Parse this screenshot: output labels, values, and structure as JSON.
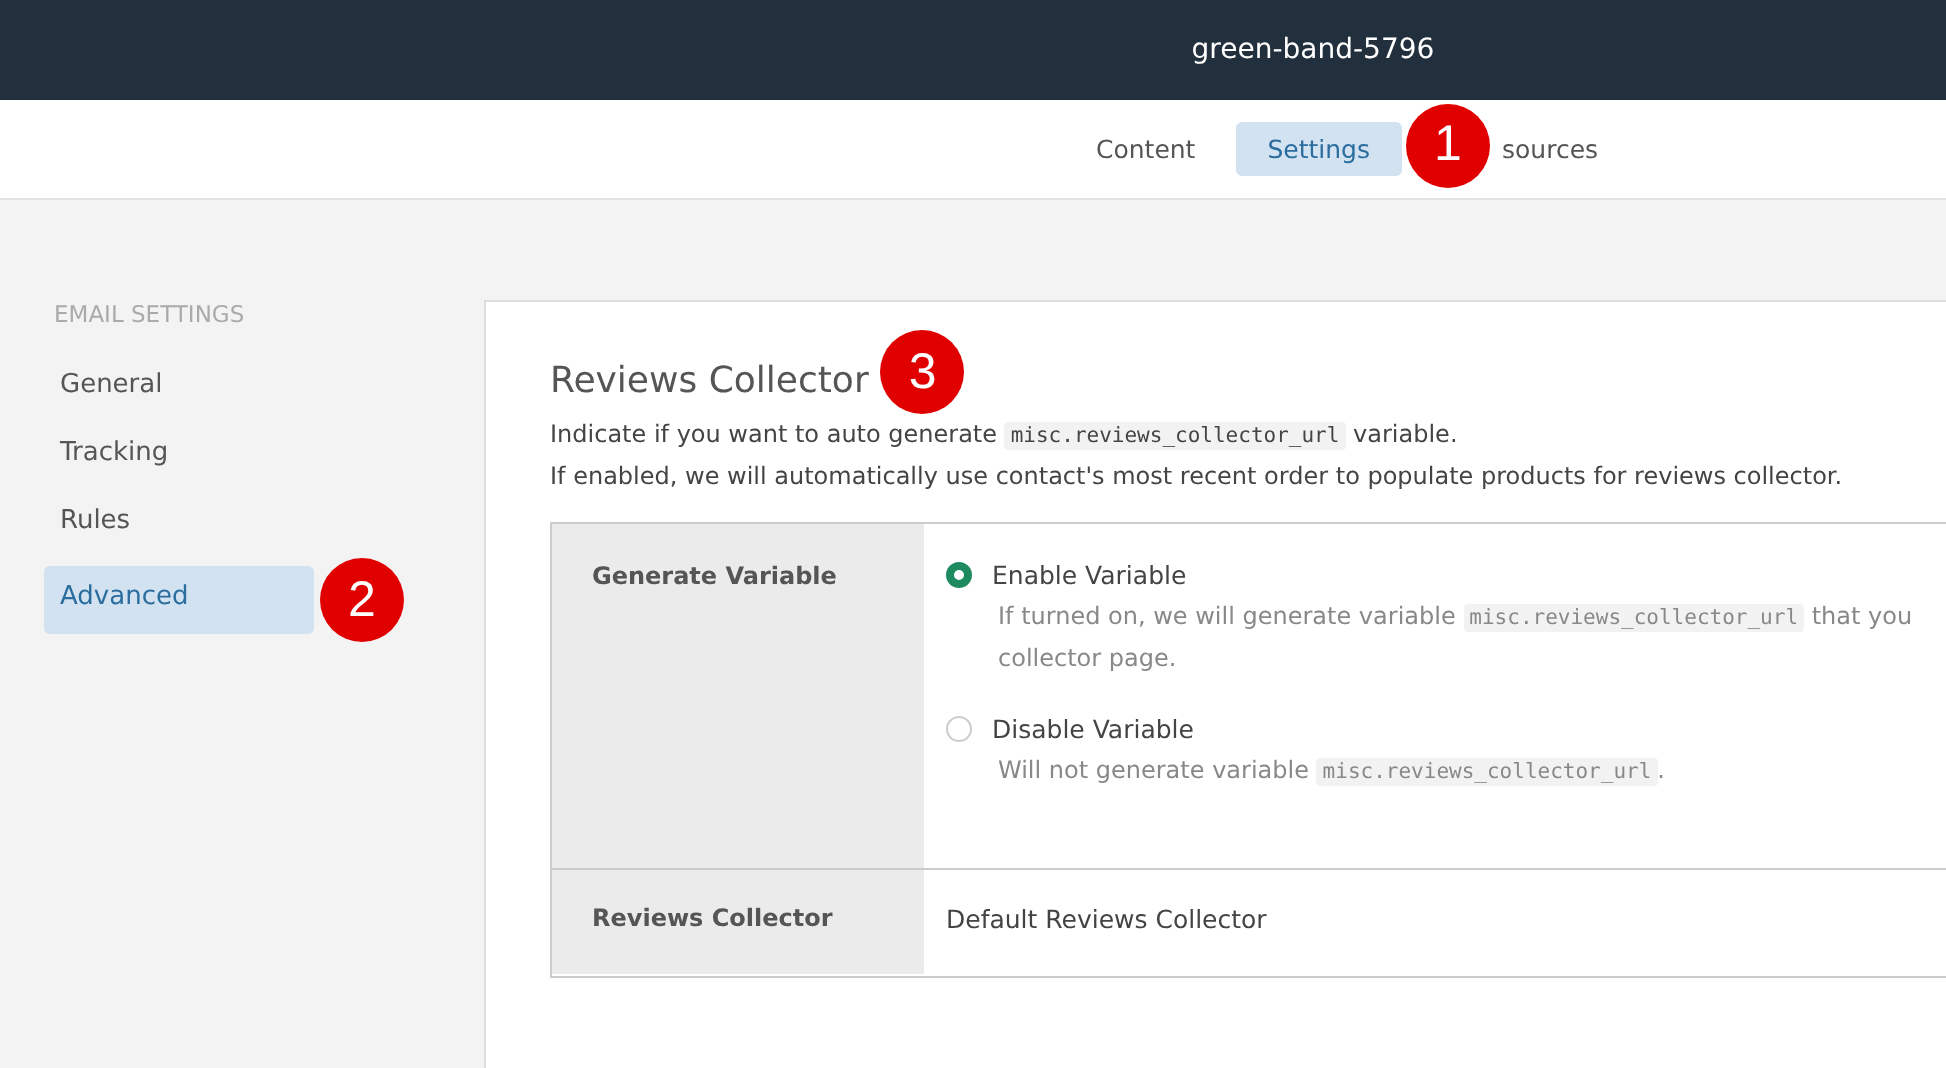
{
  "header": {
    "title": "green-band-5796"
  },
  "tabs": [
    {
      "label": "Content",
      "selected": false
    },
    {
      "label": "Settings",
      "selected": true,
      "marker": "1"
    },
    {
      "label": "sources",
      "selected": false
    }
  ],
  "sidebar": {
    "heading": "EMAIL SETTINGS",
    "items": [
      {
        "label": "General",
        "selected": false
      },
      {
        "label": "Tracking",
        "selected": false
      },
      {
        "label": "Rules",
        "selected": false
      },
      {
        "label": "Advanced",
        "selected": true,
        "marker": "2"
      }
    ]
  },
  "section": {
    "title": "Reviews Collector",
    "title_marker": "3",
    "description": [
      [
        {
          "kind": "text",
          "text": "Indicate if you want to auto generate "
        },
        {
          "kind": "code",
          "text": "misc.reviews_collector_url"
        },
        {
          "kind": "text",
          "text": " variable."
        }
      ],
      [
        {
          "kind": "text",
          "text": "If enabled, we will automatically use contact's most recent order to populate products for reviews collector."
        }
      ]
    ],
    "rows": [
      {
        "label": "Generate Variable",
        "kind": "radios",
        "options": [
          {
            "label": "Enable Variable",
            "selected": true,
            "hint": [
              {
                "kind": "text",
                "text": "If turned on, we will generate variable "
              },
              {
                "kind": "code",
                "text": "misc.reviews_collector_url"
              },
              {
                "kind": "text",
                "text": " that you"
              },
              {
                "kind": "break"
              },
              {
                "kind": "text",
                "text": "collector page."
              }
            ]
          },
          {
            "label": "Disable Variable",
            "selected": false,
            "hint": [
              {
                "kind": "text",
                "text": "Will not generate variable "
              },
              {
                "kind": "code",
                "text": "misc.reviews_collector_url"
              },
              {
                "kind": "text",
                "text": "."
              }
            ]
          }
        ]
      },
      {
        "label": "Reviews Collector",
        "kind": "text",
        "value": "Default Reviews Collector"
      }
    ]
  }
}
